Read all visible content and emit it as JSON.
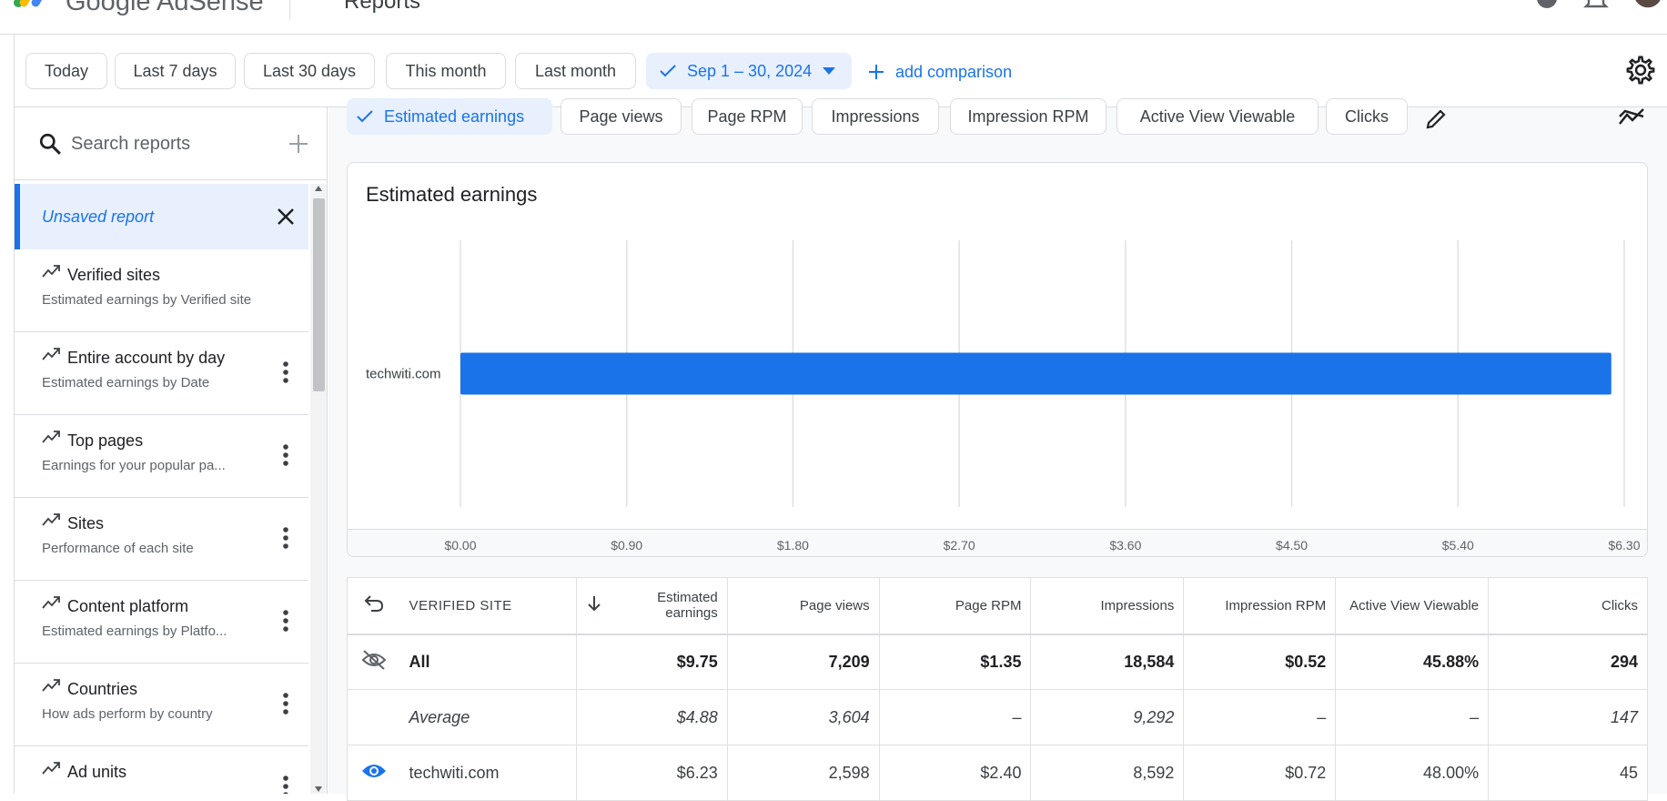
{
  "app": {
    "name": "Google AdSense",
    "section_title": "Reports"
  },
  "date_filters": {
    "chips": [
      "Today",
      "Last 7 days",
      "Last 30 days",
      "This month",
      "Last month"
    ],
    "selected_range": "Sep 1 – 30, 2024",
    "add_comparison_label": "add comparison"
  },
  "sidebar": {
    "search_placeholder": "Search reports",
    "unsaved_label": "Unsaved report",
    "reports": [
      {
        "title": "Verified sites",
        "subtitle": "Estimated earnings by Verified site"
      },
      {
        "title": "Entire account by day",
        "subtitle": "Estimated earnings by Date"
      },
      {
        "title": "Top pages",
        "subtitle": "Earnings for your popular pa..."
      },
      {
        "title": "Sites",
        "subtitle": "Performance of each site"
      },
      {
        "title": "Content platform",
        "subtitle": "Estimated earnings by Platfo..."
      },
      {
        "title": "Countries",
        "subtitle": "How ads perform by country"
      },
      {
        "title": "Ad units",
        "subtitle": ""
      }
    ]
  },
  "metrics": {
    "chips": [
      "Estimated earnings",
      "Page views",
      "Page RPM",
      "Impressions",
      "Impression RPM",
      "Active View Viewable",
      "Clicks"
    ],
    "selected": "Estimated earnings"
  },
  "colors": {
    "accent": "#1a73e8",
    "accent_light": "#e8f0fe",
    "bar": "#1a73e8"
  },
  "icons": {
    "search": "search-icon",
    "add": "plus-icon",
    "close": "close-icon",
    "menu": "more-vert-icon",
    "settings": "gear-icon",
    "edit": "pencil-icon",
    "trend": "trend-icon",
    "visibility_off": "eye-off-icon",
    "visibility_on": "eye-icon",
    "undo": "undo-icon",
    "sort": "arrow-down-icon"
  },
  "chart_data": {
    "type": "bar",
    "orientation": "horizontal",
    "title": "Estimated earnings",
    "categories": [
      "techwiti.com"
    ],
    "values": [
      6.23
    ],
    "xlim": [
      0,
      6.3
    ],
    "x_ticks": [
      "$0.00",
      "$0.90",
      "$1.80",
      "$2.70",
      "$3.60",
      "$4.50",
      "$5.40",
      "$6.30"
    ],
    "grid": true,
    "legend": "none"
  },
  "table": {
    "columns": {
      "site": "VERIFIED SITE",
      "earnings": "Estimated earnings",
      "page_views": "Page views",
      "page_rpm": "Page RPM",
      "impressions": "Impressions",
      "impression_rpm": "Impression RPM",
      "active_view": "Active View Viewable",
      "clicks": "Clicks"
    },
    "rows": {
      "all": {
        "site": "All",
        "earnings": "$9.75",
        "page_views": "7,209",
        "page_rpm": "$1.35",
        "impressions": "18,584",
        "impression_rpm": "$0.52",
        "active_view": "45.88%",
        "clicks": "294"
      },
      "average": {
        "site": "Average",
        "earnings": "$4.88",
        "page_views": "3,604",
        "page_rpm": "–",
        "impressions": "9,292",
        "impression_rpm": "–",
        "active_view": "–",
        "clicks": "147"
      },
      "techwiti": {
        "site": "techwiti.com",
        "earnings": "$6.23",
        "page_views": "2,598",
        "page_rpm": "$2.40",
        "impressions": "8,592",
        "impression_rpm": "$0.72",
        "active_view": "48.00%",
        "clicks": "45"
      }
    }
  }
}
